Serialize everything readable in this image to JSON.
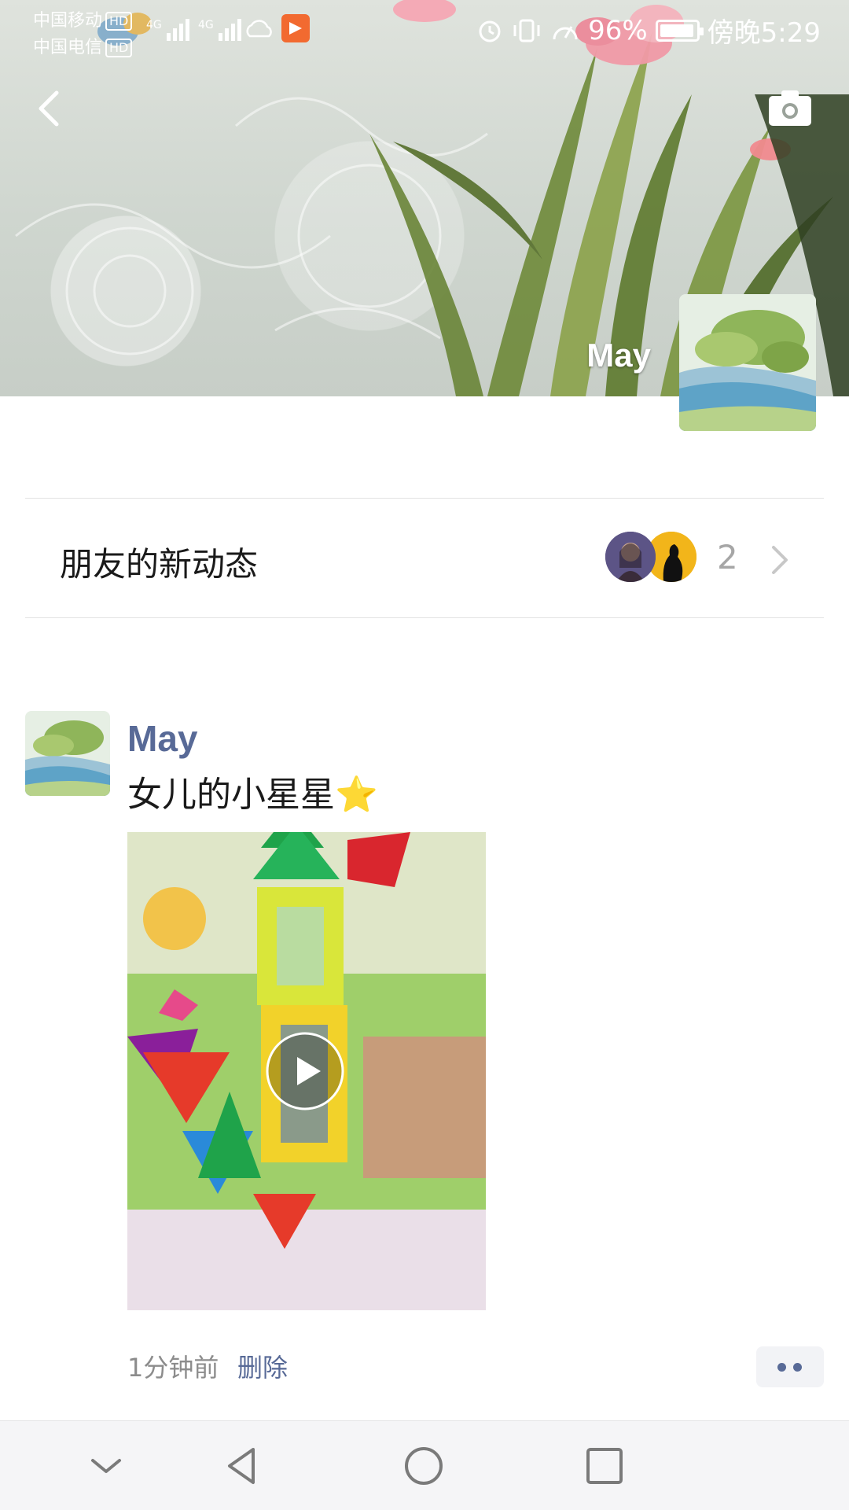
{
  "status_bar": {
    "carrier_1": "中国移动",
    "carrier_2": "中国电信",
    "hd_1": "HD",
    "hd_2": "HD",
    "network_1": "4G",
    "network_2": "4G",
    "battery_level": 0.96,
    "battery_text": "96%",
    "time": "傍晚5:29"
  },
  "header": {
    "back_icon": "chevron-left-icon",
    "camera_icon": "camera-icon",
    "profile_name": "May"
  },
  "friends_updates": {
    "title": "朋友的新动态",
    "count": "2"
  },
  "post": {
    "author": "May",
    "text": "女儿的小星星",
    "emoji": "⭐",
    "time": "1分钟前",
    "delete_label": "删除",
    "media_type": "video"
  },
  "navbar": {
    "items": [
      "collapse-icon",
      "back-icon",
      "home-icon",
      "recents-icon"
    ]
  },
  "colors": {
    "link": "#586a97",
    "secondary_text": "#8c8c8c",
    "divider": "#e3e3e3"
  }
}
